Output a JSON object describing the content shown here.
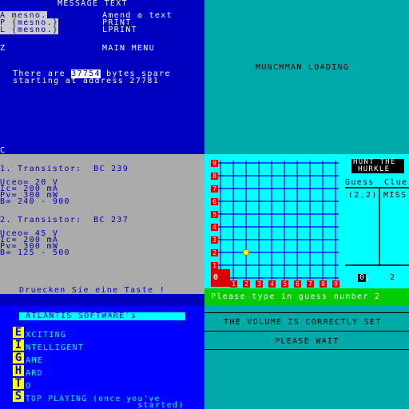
{
  "message_text": {
    "title": "MESSAGE TEXT",
    "menu_left": [
      "A mesno.",
      "P {mesno.}",
      "L {mesno.}"
    ],
    "menu_right": [
      "Amend a text",
      "PRINT",
      "LPRINT"
    ],
    "z_key": "Z",
    "z_label": "MAIN MENU",
    "free_prefix": "There are",
    "free_bytes": "37754",
    "free_suffix": "bytes spare",
    "address_line": "starting at address 27781",
    "cursor": "C"
  },
  "munchman": {
    "status": "MUNCHMAN LOADING"
  },
  "transistors": {
    "t1_title": "1. Transistor:  BC 239",
    "t1_lines": [
      "Uceo= 20 V",
      "Ic= 200 mA",
      "Pv= 300 mW",
      "B= 240 - 900"
    ],
    "t2_title": "2. Transistor:  BC 237",
    "t2_lines": [
      "Uceo= 45 V",
      "Ic= 200 mA",
      "Pv= 300 mW",
      "B= 125 - 500"
    ],
    "prompt": "Druecken Sie eine Taste !"
  },
  "hurkle": {
    "title_line1": "HUNT THE",
    "title_line2": "HURKLE",
    "col_guess": "Guess",
    "col_clue": "Clue",
    "guess_value": "(2,2)",
    "clue_value": "MISS",
    "y_labels": [
      "9",
      "8",
      "7",
      "6",
      "5",
      "4",
      "3",
      "2",
      "1",
      "0"
    ],
    "x_labels": [
      "1",
      "2",
      "3",
      "4",
      "5",
      "6",
      "7",
      "8",
      "9"
    ],
    "bottom_left": "0,",
    "bottom_right": "2",
    "prompt": "Please type in guess number 2"
  },
  "eights": {
    "header": "ATLANTIS SOFTWARE's",
    "letters": [
      "E",
      "I",
      "G",
      "H",
      "T",
      "S"
    ],
    "items": [
      "XCITING",
      "NTELLIGENT",
      "AME",
      "ARD",
      "O",
      "TOP PLAYING (once you've"
    ],
    "trailer": "started)"
  },
  "volume": {
    "line1": "THE VOLUME IS CORRECTLY SET",
    "line2": "PLEASE WAIT"
  }
}
